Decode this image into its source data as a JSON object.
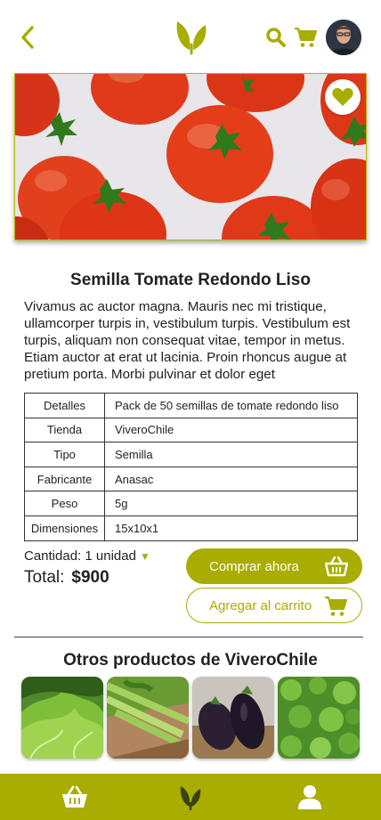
{
  "colors": {
    "accent": "#a8ad00",
    "text": "#222222",
    "white": "#ffffff"
  },
  "header": {
    "back_icon": "chevron-left-icon",
    "logo_icon": "leaf-logo-icon",
    "search_icon": "search-icon",
    "cart_icon": "shopping-cart-icon",
    "avatar_icon": "user-avatar"
  },
  "product": {
    "image_alt": "Tomatoes",
    "favorite_icon": "heart-icon",
    "title": "Semilla Tomate Redondo Liso",
    "description": "Vivamus ac auctor magna. Mauris nec mi tristique, ullamcorper turpis in, vestibulum turpis. Vestibulum est turpis, aliquam non consequat vitae, tempor in metus. Etiam auctor at erat ut lacinia. Proin rhoncus augue at pretium porta. Morbi pulvinar et dolor eget",
    "details": [
      {
        "key": "Detalles",
        "value": "Pack de 50 semillas de tomate redondo liso"
      },
      {
        "key": "Tienda",
        "value": "ViveroChile"
      },
      {
        "key": "Tipo",
        "value": "Semilla"
      },
      {
        "key": "Fabricante",
        "value": "Anasac"
      },
      {
        "key": "Peso",
        "value": "5g"
      },
      {
        "key": "Dimensiones",
        "value": "15x10x1"
      }
    ]
  },
  "purchase": {
    "quantity_label": "Cantidad: 1 unidad",
    "total_label": "Total:",
    "total_amount": "$900",
    "buy_now_label": "Comprar ahora",
    "add_to_cart_label": "Agregar al carrito"
  },
  "others": {
    "title": "Otros productos de ViveroChile",
    "items": [
      "lettuce",
      "celery",
      "eggplant",
      "oregano"
    ]
  },
  "bottom_nav": {
    "items": [
      "basket-icon",
      "leaf-icon",
      "user-icon"
    ]
  }
}
